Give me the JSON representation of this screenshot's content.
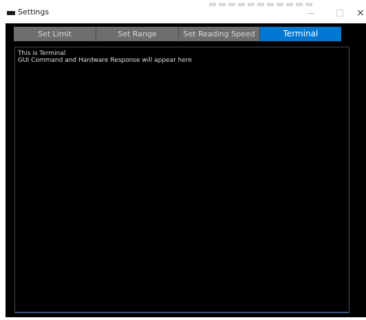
{
  "window": {
    "title": "Settings",
    "controls": {
      "minimize": "–",
      "maximize": "□",
      "close": "×"
    }
  },
  "tabs": [
    {
      "label": "Set Limit",
      "active": false
    },
    {
      "label": "Set Range",
      "active": false
    },
    {
      "label": "Set Reading Speed",
      "active": false
    },
    {
      "label": "Terminal",
      "active": true
    }
  ],
  "terminal": {
    "lines": [
      "This is Terminal",
      "GUI Command and Hardware Response will appear here"
    ]
  },
  "colors": {
    "active_tab": "#0078d4",
    "inactive_tab": "#6e6e6e",
    "background": "#000000"
  }
}
